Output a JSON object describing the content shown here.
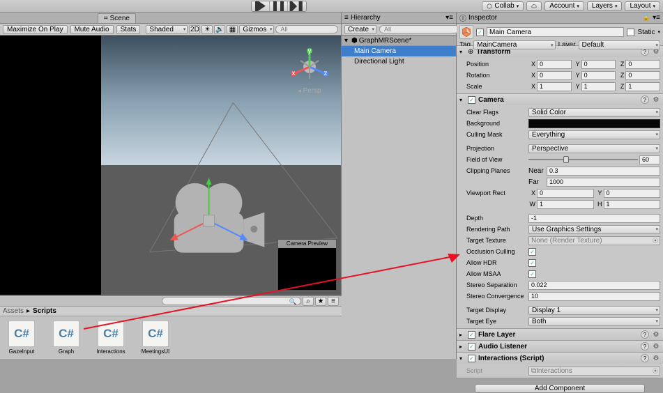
{
  "top": {
    "collab": "Collab",
    "account": "Account",
    "layers": "Layers",
    "layout": "Layout"
  },
  "scene": {
    "tab": "Scene",
    "maximize": "Maximize On Play",
    "mute": "Mute Audio",
    "stats": "Stats",
    "shaded": "Shaded",
    "mode2d": "2D",
    "gizmos": "Gizmos",
    "persp": "Persp",
    "camera_preview": "Camera Preview"
  },
  "hierarchy": {
    "tab": "Hierarchy",
    "create": "Create",
    "scene_name": "GraphMRScene*",
    "items": [
      "Main Camera",
      "Directional Light"
    ]
  },
  "project": {
    "breadcrumb_root": "Assets",
    "breadcrumb_sep": "▸",
    "breadcrumb_folder": "Scripts",
    "assets": [
      "GazeInput",
      "Graph",
      "Interactions",
      "MeetingsUI"
    ]
  },
  "inspector": {
    "tab": "Inspector",
    "name": "Main Camera",
    "static": "Static",
    "tag_label": "Tag",
    "tag_value": "MainCamera",
    "layer_label": "Layer",
    "layer_value": "Default",
    "transform": {
      "title": "Transform",
      "position": "Position",
      "px": "0",
      "py": "0",
      "pz": "0",
      "rotation": "Rotation",
      "rx": "0",
      "ry": "0",
      "rz": "0",
      "scale": "Scale",
      "sx": "1",
      "sy": "1",
      "sz": "1"
    },
    "camera": {
      "title": "Camera",
      "clear_flags": "Clear Flags",
      "clear_flags_v": "Solid Color",
      "background": "Background",
      "culling": "Culling Mask",
      "culling_v": "Everything",
      "projection": "Projection",
      "projection_v": "Perspective",
      "fov": "Field of View",
      "fov_v": "60",
      "clip": "Clipping Planes",
      "near_l": "Near",
      "near_v": "0.3",
      "far_l": "Far",
      "far_v": "1000",
      "viewport": "Viewport Rect",
      "vx": "0",
      "vy": "0",
      "vw": "1",
      "vh": "1",
      "depth": "Depth",
      "depth_v": "-1",
      "render_path": "Rendering Path",
      "render_path_v": "Use Graphics Settings",
      "target_tex": "Target Texture",
      "target_tex_v": "None (Render Texture)",
      "occ": "Occlusion Culling",
      "hdr": "Allow HDR",
      "msaa": "Allow MSAA",
      "stereo_sep": "Stereo Separation",
      "stereo_sep_v": "0.022",
      "stereo_conv": "Stereo Convergence",
      "stereo_conv_v": "10",
      "target_disp": "Target Display",
      "target_disp_v": "Display 1",
      "target_eye": "Target Eye",
      "target_eye_v": "Both"
    },
    "flare": "Flare Layer",
    "audio": "Audio Listener",
    "interactions_comp": "Interactions (Script)",
    "script_label": "Script",
    "script_value": "Interactions",
    "add_component": "Add Component"
  }
}
